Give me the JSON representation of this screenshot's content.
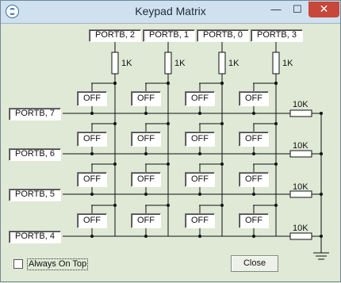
{
  "window": {
    "title": "Keypad Matrix",
    "buttons": {
      "minimize": "—",
      "maximize": "☐",
      "close": "✕"
    }
  },
  "columns": [
    "PORTB, 2",
    "PORTB, 1",
    "PORTB, 0",
    "PORTB, 3"
  ],
  "column_resistor": "1K",
  "rows": [
    "PORTB, 7",
    "PORTB, 6",
    "PORTB, 5",
    "PORTB, 4"
  ],
  "row_resistor": "10K",
  "keys": [
    [
      "OFF",
      "OFF",
      "OFF",
      "OFF"
    ],
    [
      "OFF",
      "OFF",
      "OFF",
      "OFF"
    ],
    [
      "OFF",
      "OFF",
      "OFF",
      "OFF"
    ],
    [
      "OFF",
      "OFF",
      "OFF",
      "OFF"
    ]
  ],
  "always_on_top": {
    "label": "Always On Top",
    "checked": false
  },
  "close_button": "Close",
  "colors": {
    "background": "#dfe9d6",
    "titlebar": "#cfe0ef",
    "close_button": "#c7473a"
  }
}
